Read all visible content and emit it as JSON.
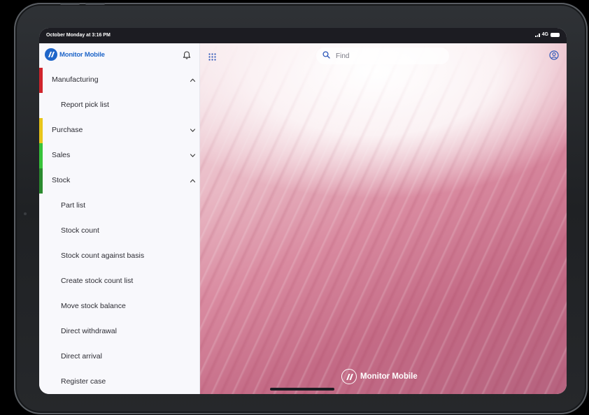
{
  "status_bar": {
    "time": "October Monday at 3:16 PM",
    "network": "4G"
  },
  "sidebar": {
    "logo_text": "Monitor Mobile",
    "items": [
      {
        "label": "Manufacturing",
        "level": 0,
        "bar_color": "#d0242c",
        "chevron": "up"
      },
      {
        "label": "Report pick list",
        "level": 1
      },
      {
        "label": "Purchase",
        "level": 0,
        "bar_color": "#e8c51a",
        "chevron": "down"
      },
      {
        "label": "Sales",
        "level": 0,
        "bar_color": "#37c23a",
        "chevron": "down"
      },
      {
        "label": "Stock",
        "level": 0,
        "bar_color": "#2b8a2f",
        "chevron": "up"
      },
      {
        "label": "Part list",
        "level": 1
      },
      {
        "label": "Stock count",
        "level": 1
      },
      {
        "label": "Stock count against basis",
        "level": 1
      },
      {
        "label": "Create stock count list",
        "level": 1
      },
      {
        "label": "Move stock balance",
        "level": 1
      },
      {
        "label": "Direct withdrawal",
        "level": 1
      },
      {
        "label": "Direct arrival",
        "level": 1
      },
      {
        "label": "Register case",
        "level": 1
      }
    ]
  },
  "main": {
    "search_placeholder": "Find",
    "watermark_text": "Monitor Mobile"
  },
  "colors": {
    "brand": "#1f66c9",
    "status_bar_bg": "#1c1c22",
    "sidebar_bg": "#f8f8fc"
  }
}
